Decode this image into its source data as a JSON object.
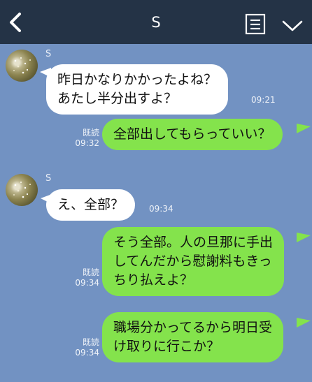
{
  "header": {
    "title": "S",
    "back_icon": "chevron-left-icon",
    "menu_icon": "notes-menu-icon",
    "dropdown_icon": "chevron-down-icon"
  },
  "colors": {
    "header_bg": "#243346",
    "chat_bg": "#7292c2",
    "incoming_bubble": "#ffffff",
    "outgoing_bubble": "#84e34c"
  },
  "messages": [
    {
      "side": "in",
      "sender": "S",
      "text": "昨日かなりかかったよね？\nあたし半分出すよ？",
      "time": "09:21"
    },
    {
      "side": "out",
      "text": "全部出してもらっていい？",
      "read": "既読",
      "time": "09:32"
    },
    {
      "side": "in",
      "sender": "S",
      "text": "え、全部？",
      "time": "09:34"
    },
    {
      "side": "out",
      "text": "そう全部。人の旦那に手出\nしてんだから慰謝料もきっ\nちり払えよ？",
      "read": "既読",
      "time": "09:34"
    },
    {
      "side": "out",
      "text": "職場分かってるから明日受\nけ取りに行こか？",
      "read": "既読",
      "time": "09:34"
    }
  ]
}
